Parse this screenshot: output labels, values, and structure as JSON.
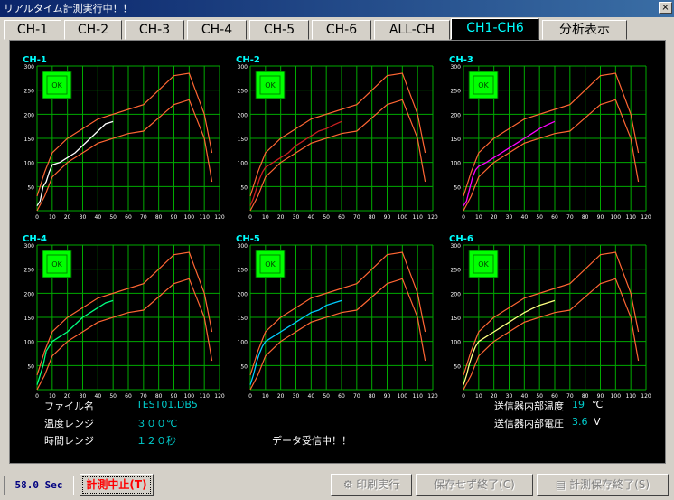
{
  "window": {
    "title": "リアルタイム計測実行中！！",
    "close_label": "×"
  },
  "tabs": [
    {
      "label": "CH-1"
    },
    {
      "label": "CH-2"
    },
    {
      "label": "CH-3"
    },
    {
      "label": "CH-4"
    },
    {
      "label": "CH-5"
    },
    {
      "label": "CH-6"
    },
    {
      "label": "ALL-CH"
    },
    {
      "label": "CH1-CH6",
      "active": true
    },
    {
      "label": "分析表示"
    }
  ],
  "chart_data": [
    {
      "type": "line",
      "title": "CH-1",
      "status": "OK",
      "color": "#ffffff",
      "x": [
        0,
        2,
        4,
        6,
        8,
        10,
        15,
        20,
        25,
        30,
        35,
        40,
        45,
        50
      ],
      "y": [
        10,
        20,
        50,
        60,
        80,
        95,
        100,
        110,
        120,
        135,
        150,
        165,
        180,
        185
      ],
      "xlim": [
        0,
        120
      ],
      "ylim": [
        0,
        300
      ],
      "xticks": [
        0,
        10,
        20,
        30,
        40,
        50,
        60,
        70,
        80,
        90,
        100,
        110,
        120
      ],
      "yticks": [
        50,
        100,
        150,
        200,
        250,
        300
      ]
    },
    {
      "type": "line",
      "title": "CH-2",
      "status": "OK",
      "color": "#cc2020",
      "x": [
        0,
        2,
        4,
        6,
        8,
        10,
        15,
        20,
        25,
        30,
        35,
        40,
        45,
        50,
        55,
        60
      ],
      "y": [
        10,
        25,
        45,
        65,
        80,
        90,
        100,
        110,
        120,
        135,
        145,
        155,
        165,
        170,
        178,
        185
      ],
      "xlim": [
        0,
        120
      ],
      "ylim": [
        0,
        300
      ],
      "xticks": [
        0,
        10,
        20,
        30,
        40,
        50,
        60,
        70,
        80,
        90,
        100,
        110,
        120
      ],
      "yticks": [
        50,
        100,
        150,
        200,
        250,
        300
      ]
    },
    {
      "type": "line",
      "title": "CH-3",
      "status": "OK",
      "color": "#ff00ff",
      "x": [
        0,
        2,
        4,
        6,
        8,
        10,
        15,
        20,
        25,
        30,
        35,
        40,
        45,
        50,
        55,
        60
      ],
      "y": [
        10,
        20,
        45,
        70,
        85,
        92,
        100,
        110,
        120,
        130,
        140,
        150,
        160,
        170,
        178,
        185
      ],
      "xlim": [
        0,
        120
      ],
      "ylim": [
        0,
        300
      ],
      "xticks": [
        0,
        10,
        20,
        30,
        40,
        50,
        60,
        70,
        80,
        90,
        100,
        110,
        120
      ],
      "yticks": [
        50,
        100,
        150,
        200,
        250,
        300
      ]
    },
    {
      "type": "line",
      "title": "CH-4",
      "status": "OK",
      "color": "#00ff80",
      "x": [
        0,
        2,
        4,
        6,
        8,
        10,
        15,
        20,
        25,
        30,
        35,
        40,
        45,
        50
      ],
      "y": [
        10,
        30,
        50,
        80,
        90,
        100,
        110,
        120,
        135,
        150,
        160,
        170,
        180,
        185
      ],
      "xlim": [
        0,
        120
      ],
      "ylim": [
        0,
        300
      ],
      "xticks": [
        0,
        10,
        20,
        30,
        40,
        50,
        60,
        70,
        80,
        90,
        100,
        110,
        120
      ],
      "yticks": [
        50,
        100,
        150,
        200,
        250,
        300
      ]
    },
    {
      "type": "line",
      "title": "CH-5",
      "status": "OK",
      "color": "#00ccff",
      "x": [
        0,
        2,
        4,
        6,
        8,
        10,
        15,
        20,
        25,
        30,
        35,
        40,
        45,
        50,
        55,
        60
      ],
      "y": [
        10,
        30,
        55,
        75,
        90,
        100,
        110,
        120,
        130,
        140,
        150,
        160,
        165,
        175,
        180,
        185
      ],
      "xlim": [
        0,
        120
      ],
      "ylim": [
        0,
        300
      ],
      "xticks": [
        0,
        10,
        20,
        30,
        40,
        50,
        60,
        70,
        80,
        90,
        100,
        110,
        120
      ],
      "yticks": [
        50,
        100,
        150,
        200,
        250,
        300
      ]
    },
    {
      "type": "line",
      "title": "CH-6",
      "status": "OK",
      "color": "#ffff80",
      "x": [
        0,
        2,
        4,
        6,
        8,
        10,
        15,
        20,
        25,
        30,
        35,
        40,
        45,
        50,
        55,
        60
      ],
      "y": [
        10,
        30,
        55,
        75,
        90,
        100,
        110,
        120,
        130,
        140,
        150,
        160,
        168,
        175,
        180,
        185
      ],
      "xlim": [
        0,
        120
      ],
      "ylim": [
        0,
        300
      ],
      "xticks": [
        0,
        10,
        20,
        30,
        40,
        50,
        60,
        70,
        80,
        90,
        100,
        110,
        120
      ],
      "yticks": [
        50,
        100,
        150,
        200,
        250,
        300
      ]
    }
  ],
  "envelope": {
    "color": "#ff6633",
    "upper": {
      "x": [
        0,
        5,
        10,
        20,
        40,
        60,
        70,
        90,
        100,
        110,
        115
      ],
      "y": [
        30,
        80,
        120,
        150,
        190,
        210,
        220,
        280,
        285,
        200,
        120
      ]
    },
    "lower": {
      "x": [
        0,
        5,
        10,
        20,
        40,
        60,
        70,
        90,
        100,
        110,
        115
      ],
      "y": [
        0,
        30,
        70,
        100,
        140,
        160,
        165,
        220,
        230,
        150,
        60
      ]
    }
  },
  "info": {
    "file_label": "ファイル名",
    "file_value": "TEST01.DB5",
    "temp_range_label": "温度レンジ",
    "temp_range_value": "３００℃",
    "time_range_label": "時間レンジ",
    "time_range_value": "１２０秒",
    "receiving": "データ受信中！！",
    "transmitter_temp_label": "送信器内部温度",
    "transmitter_temp_value": "19",
    "transmitter_temp_unit": "℃",
    "transmitter_volt_label": "送信器内部電圧",
    "transmitter_volt_value": "3.6",
    "transmitter_volt_unit": "V"
  },
  "status": {
    "elapsed": "58.0 Sec"
  },
  "buttons": {
    "stop": "計測中止(T)",
    "print": "印刷実行",
    "exit_no_save": "保存せず終了(C)",
    "save_exit": "計測保存終了(S)"
  },
  "colors": {
    "grid": "#00aa00",
    "axis_label": "#00ffff",
    "ok_bg": "#00ff00",
    "tick_text": "#ffffff"
  }
}
